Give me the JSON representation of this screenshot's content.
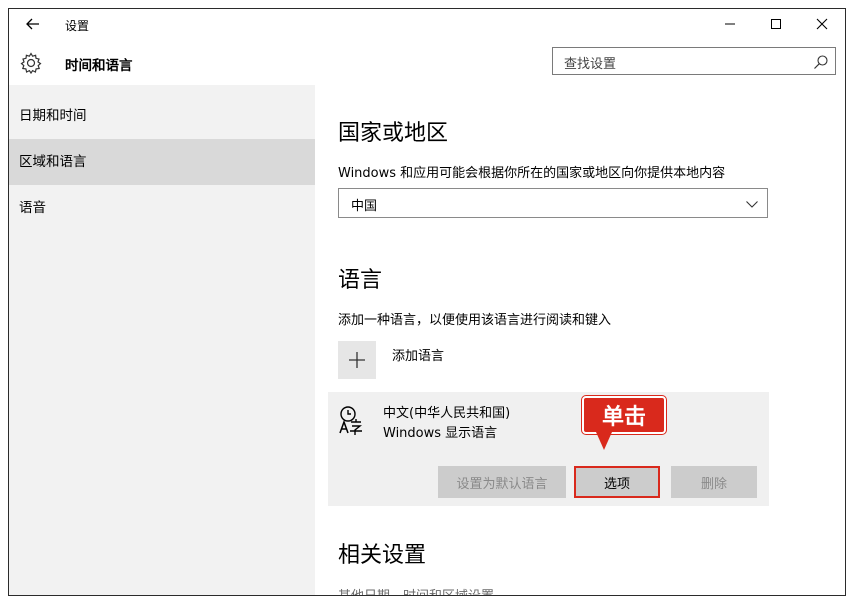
{
  "window": {
    "title": "设置",
    "controls": {
      "minimize": "minimize-icon",
      "maximize": "maximize-icon",
      "close": "close-icon"
    }
  },
  "header": {
    "app_title": "时间和语言",
    "search_placeholder": "查找设置"
  },
  "sidebar": {
    "items": [
      {
        "label": "日期和时间"
      },
      {
        "label": "区域和语言",
        "selected": true
      },
      {
        "label": "语音"
      }
    ]
  },
  "main": {
    "region": {
      "heading": "国家或地区",
      "description": "Windows 和应用可能会根据你所在的国家或地区向你提供本地内容",
      "selected_value": "中国"
    },
    "language": {
      "heading": "语言",
      "description": "添加一种语言，以便使用该语言进行阅读和键入",
      "add_label": "添加语言",
      "entries": [
        {
          "name": "中文(中华人民共和国)",
          "subtitle": "Windows 显示语言"
        }
      ],
      "buttons": {
        "set_default": "设置为默认语言",
        "options": "选项",
        "remove": "删除"
      }
    },
    "related": {
      "heading": "相关设置",
      "link": "其他日期、时间和区域设置"
    }
  },
  "annotation": {
    "callout": "单击"
  },
  "colors": {
    "accent_red": "#d9291c",
    "sidebar_bg": "#f2f2f2",
    "selected_bg": "#d9d9d9"
  }
}
